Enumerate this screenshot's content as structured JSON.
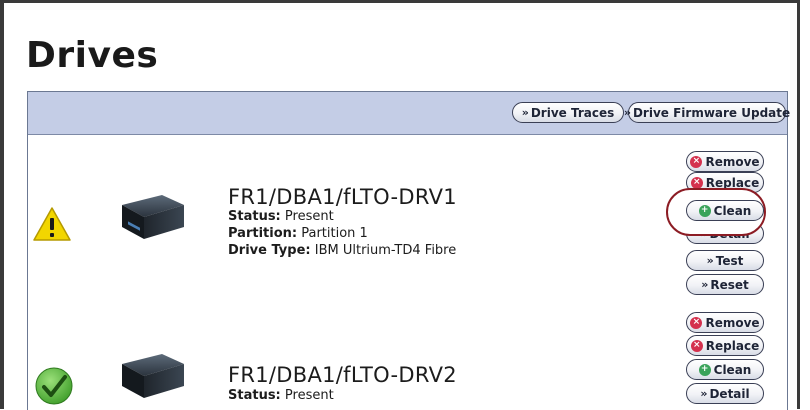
{
  "page": {
    "title": "Drives"
  },
  "toolbar": {
    "drive_traces": "Drive Traces",
    "firmware_update": "Drive Firmware Update"
  },
  "drives": [
    {
      "name": "FR1/DBA1/fLTO-DRV1",
      "status_label": "Status:",
      "status": "Present",
      "partition_label": "Partition:",
      "partition": "Partition 1",
      "type_label": "Drive Type:",
      "type": "IBM Ultrium-TD4 Fibre",
      "state_icon": "warning-icon",
      "actions": {
        "remove": "Remove",
        "replace": "Replace",
        "clean": "Clean",
        "detail": "Detail",
        "test": "Test",
        "reset": "Reset"
      }
    },
    {
      "name": "FR1/DBA1/fLTO-DRV2",
      "status_label": "Status:",
      "status": "Present",
      "state_icon": "check-icon",
      "actions": {
        "remove": "Remove",
        "replace": "Replace",
        "clean": "Clean",
        "detail": "Detail"
      }
    }
  ],
  "colors": {
    "toolbar_bg": "#c4cde6",
    "highlight": "#8c1c24",
    "remove_icon": "#d4314e",
    "clean_icon": "#3aa35a",
    "warning": "#f2d600",
    "ok": "#3f9e2a"
  }
}
